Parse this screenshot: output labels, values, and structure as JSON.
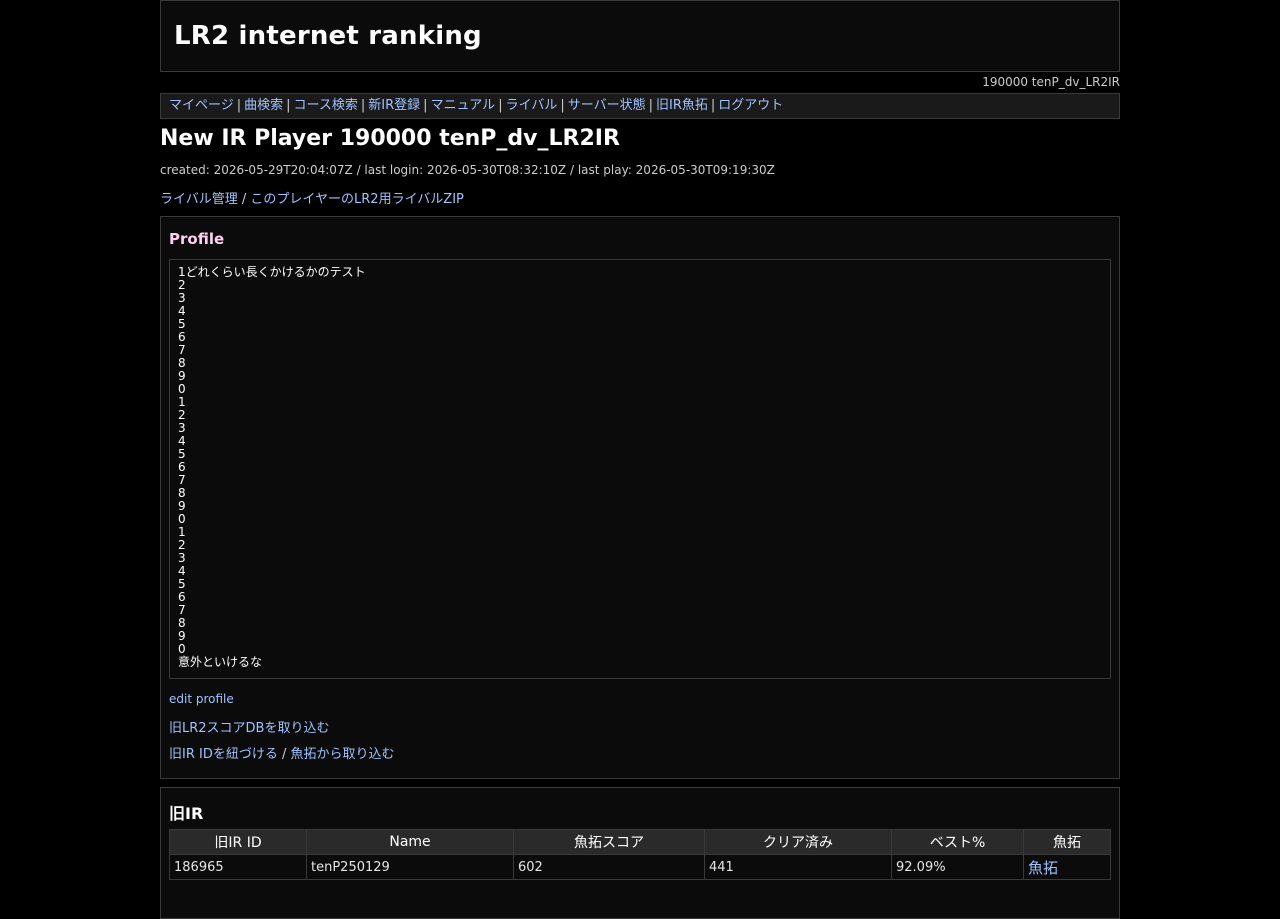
{
  "header": {
    "site_title": "LR2 internet ranking",
    "user_id_label": "190000 tenP_dv_LR2IR"
  },
  "nav": {
    "items": [
      {
        "label": "マイページ"
      },
      {
        "label": "曲検索"
      },
      {
        "label": "コース検索"
      },
      {
        "label": "新IR登録"
      },
      {
        "label": "マニュアル"
      },
      {
        "label": "ライバル"
      },
      {
        "label": "サーバー状態"
      },
      {
        "label": "旧IR魚拓"
      },
      {
        "label": "ログアウト"
      }
    ],
    "separator": "|"
  },
  "player": {
    "title": "New IR Player 190000 tenP_dv_LR2IR",
    "meta": "created: 2026-05-29T20:04:07Z / last login: 2026-05-30T08:32:10Z / last play: 2026-05-30T09:19:30Z",
    "rival_manage_link": "ライバル管理",
    "rival_sep": " / ",
    "rival_zip_link": "このプレイヤーのLR2用ライバルZIP"
  },
  "profile": {
    "title": "Profile",
    "text": "1どれくらい長くかけるかのテスト\n2\n3\n4\n5\n6\n7\n8\n9\n0\n1\n2\n3\n4\n5\n6\n7\n8\n9\n0\n1\n2\n3\n4\n5\n6\n7\n8\n9\n0\n意外といけるな",
    "edit_link": "edit profile",
    "import_db_link": "旧LR2スコアDBを取り込む",
    "link_old_id_link": "旧IR IDを紐づける",
    "link_sep": " / ",
    "import_gyotaku_link": "魚拓から取り込む"
  },
  "old_ir": {
    "title": "旧IR",
    "columns": [
      "旧IR ID",
      "Name",
      "魚拓スコア",
      "クリア済み",
      "ベスト%",
      "魚拓"
    ],
    "rows": [
      {
        "id": "186965",
        "name": "tenP250129",
        "score": "602",
        "cleared": "441",
        "best": "92.09%",
        "gyotaku": "魚拓"
      }
    ]
  }
}
